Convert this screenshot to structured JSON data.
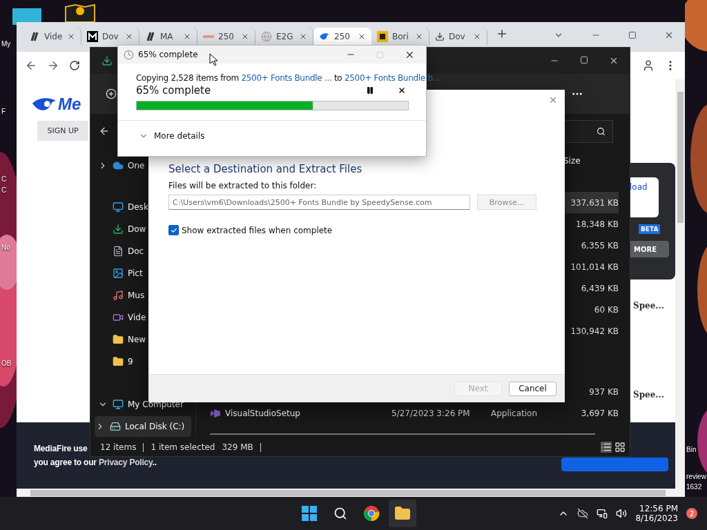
{
  "desktop": {
    "left_labels": [
      "My",
      "F",
      "C",
      "C",
      "No",
      "OB"
    ],
    "right_labels": [
      "Bin",
      "review",
      "1632"
    ]
  },
  "browser": {
    "tabs": [
      {
        "label": "Vide",
        "kind": "slashes",
        "selected": false
      },
      {
        "label": "Dov",
        "kind": "square",
        "selected": false
      },
      {
        "label": "MA",
        "kind": "slashes",
        "selected": false
      },
      {
        "label": "250",
        "kind": "stripe",
        "selected": false
      },
      {
        "label": "E2G",
        "kind": "globe",
        "selected": false
      },
      {
        "label": "250",
        "kind": "flame",
        "selected": true
      },
      {
        "label": "Bori",
        "kind": "yellow",
        "selected": false
      },
      {
        "label": "Dov",
        "kind": "download",
        "selected": false
      }
    ],
    "page": {
      "logo": "Me",
      "sign_up": "SIGN UP",
      "side_button": "load",
      "beta": "BETA",
      "more": "MORE",
      "captions": [
        "Spee...",
        "Spee..."
      ],
      "cookie_line_1": "MediaFire use",
      "cookie_line_2": "you agree to our",
      "privacy_link": "Privacy Policy",
      "cookie_end": ".."
    }
  },
  "explorer": {
    "sidebar": [
      {
        "label": "One",
        "kind": "cloud",
        "expanded": false,
        "selected": false
      },
      {
        "label": "Desk",
        "kind": "desktop",
        "selected": false
      },
      {
        "label": "Dow",
        "kind": "download",
        "selected": false
      },
      {
        "label": "Doc",
        "kind": "document",
        "selected": false
      },
      {
        "label": "Pict",
        "kind": "pictures",
        "selected": false
      },
      {
        "label": "Mus",
        "kind": "music",
        "selected": false
      },
      {
        "label": "Vide",
        "kind": "videos",
        "selected": false
      },
      {
        "label": "New",
        "kind": "folder",
        "selected": false
      },
      {
        "label": "9",
        "kind": "folder",
        "selected": false
      },
      {
        "label": "My Computer",
        "kind": "computer",
        "expanded": true,
        "selected": false
      },
      {
        "label": "Local Disk (C:)",
        "kind": "disk",
        "expanded": false,
        "selected": true
      }
    ],
    "columns": [
      "Size"
    ],
    "rows": [
      {
        "size": "337,631 KB",
        "selected": true
      },
      {
        "size": "18,348 KB",
        "selected": false
      },
      {
        "size": "6,355 KB",
        "selected": false
      },
      {
        "size": "101,014 KB",
        "selected": false
      },
      {
        "size": "6,439 KB",
        "selected": false
      },
      {
        "size": "60 KB",
        "selected": false
      },
      {
        "size": "130,942 KB",
        "selected": false
      },
      {
        "size": "937 KB",
        "selected": false
      },
      {
        "name": "VisualStudioSetup",
        "date": "5/27/2023 3:26 PM",
        "type": "Application",
        "size": "3,697 KB",
        "selected": false
      }
    ],
    "status": {
      "count": "12 items",
      "selection": "1 item selected",
      "selection_size": "329 MB"
    }
  },
  "extract_dialog": {
    "heading": "Select a Destination and Extract Files",
    "folder_label": "Files will be extracted to this folder:",
    "path": "C:\\Users\\vm6\\Downloads\\2500+ Fonts Bundle by SpeedySense.com",
    "browse": "Browse...",
    "show_files": {
      "label": "Show extracted files when complete",
      "checked": true
    },
    "next": {
      "label": "Next",
      "disabled": true
    },
    "cancel": "Cancel"
  },
  "progress_dialog": {
    "title": "65% complete",
    "message": [
      {
        "text": "Copying 2,528 items from",
        "kind": "text"
      },
      {
        "text": "2500+ Fonts Bundle ...",
        "kind": "link"
      },
      {
        "text": "to",
        "kind": "text"
      },
      {
        "text": "2500+ Fonts Bundle b...",
        "kind": "link"
      }
    ],
    "status": "65% complete",
    "level": 0.65,
    "details": "More details"
  },
  "taskbar": {
    "time": "12:56 PM",
    "date": "8/16/2023",
    "notifications": "2"
  }
}
